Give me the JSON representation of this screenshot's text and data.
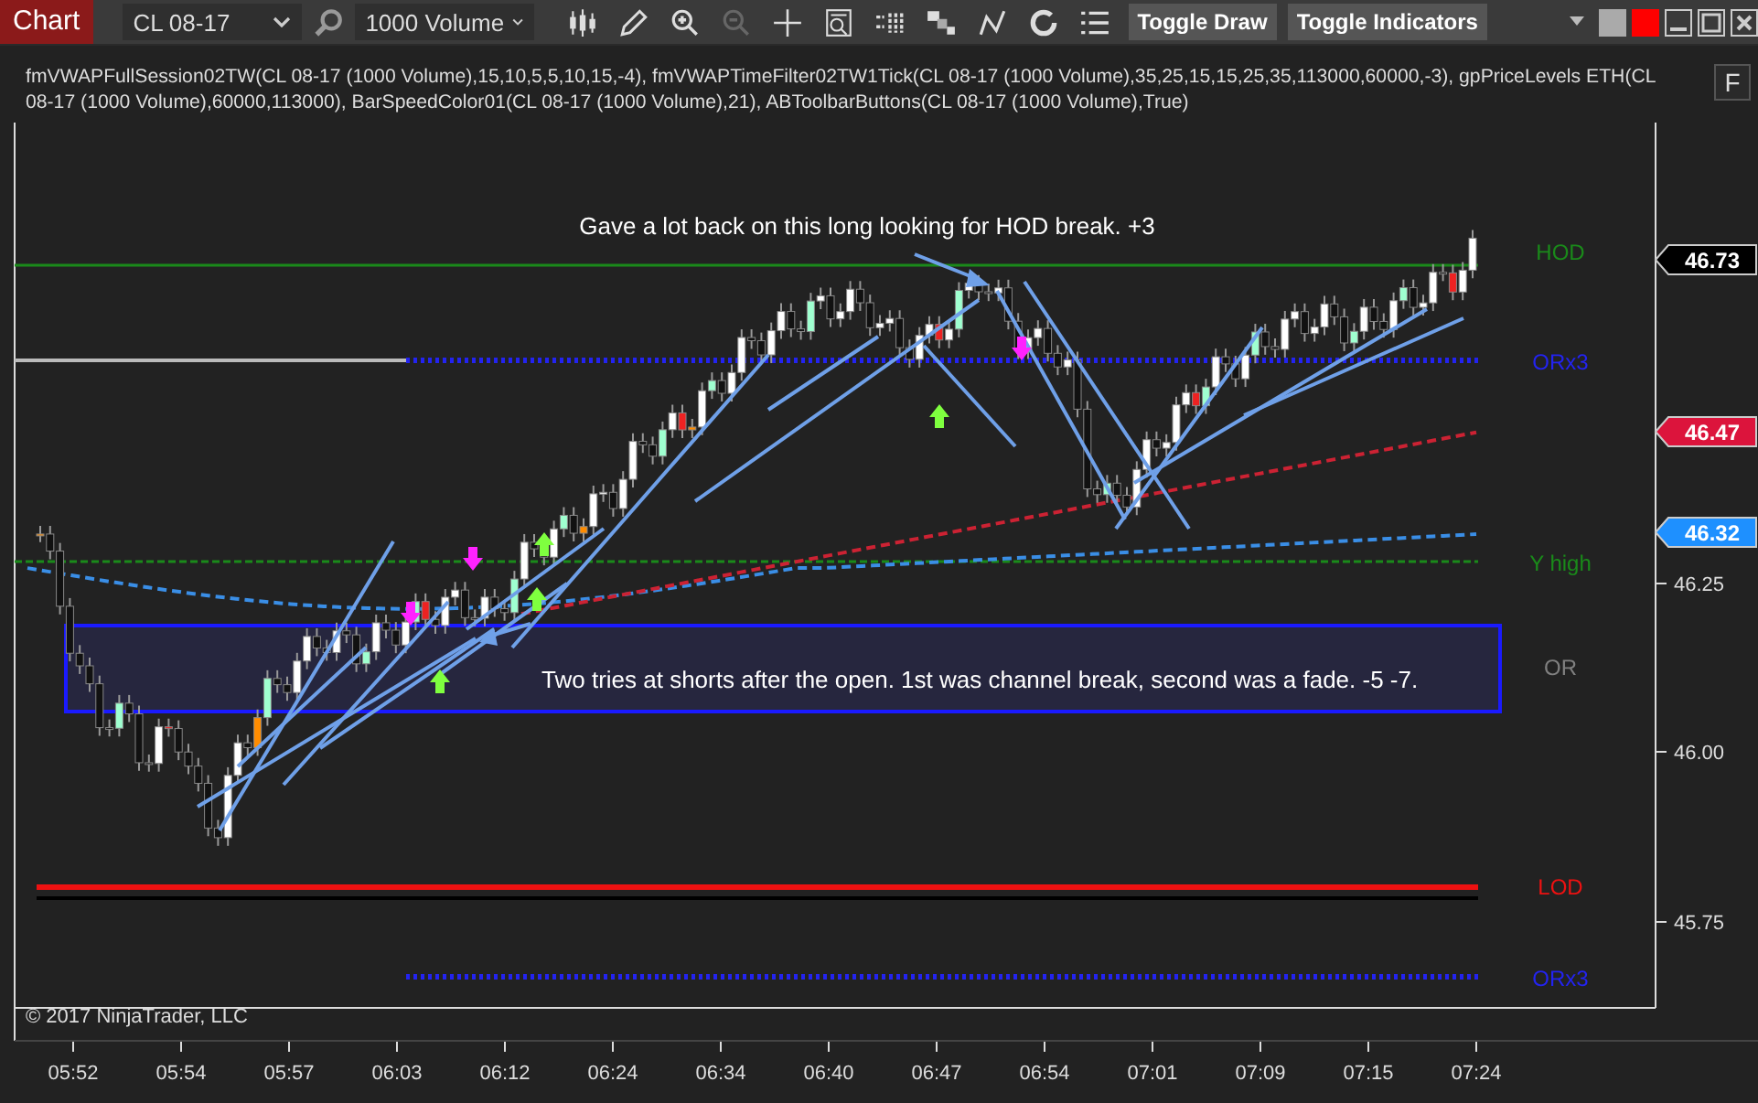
{
  "toolbar": {
    "title": "Chart",
    "instrument": "CL 08-17",
    "interval": "1000 Volume",
    "buttons": [
      "Toggle Draw",
      "Toggle Indicators"
    ]
  },
  "indicators_text": "fmVWAPFullSession02TW(CL 08-17 (1000 Volume),15,10,5,5,10,15,-4), fmVWAPTimeFilter02TW1Tick(CL 08-17 (1000 Volume),35,25,15,15,25,35,113000,60000,-3), gpPriceLevels ETH(CL 08-17 (1000 Volume),60000,113000), BarSpeedColor01(CL 08-17 (1000 Volume),21), ABToolbarButtons(CL 08-17 (1000 Volume),True)",
  "side_button": "F",
  "annotations": [
    "Gave a lot back on this long looking for HOD break.  +3",
    "Two tries at shorts after the open. 1st was channel break, second was a fade. -5 -7."
  ],
  "levels": [
    {
      "label": "HOD",
      "color": "#1a8a1a"
    },
    {
      "label": "ORx3",
      "color": "#2323f0"
    },
    {
      "label": "Y high",
      "color": "#1a8a1a"
    },
    {
      "label": "OR",
      "color": "#808080"
    },
    {
      "label": "LOD",
      "color": "#ee1111"
    },
    {
      "label": "ORx3",
      "color": "#2323f0"
    }
  ],
  "price_flags": [
    {
      "value": "46.73",
      "color": "#000000"
    },
    {
      "value": "46.47",
      "color": "#dc143c"
    },
    {
      "value": "46.32",
      "color": "#1e90ff"
    }
  ],
  "y_ticks": [
    "46.25",
    "46.00",
    "45.75"
  ],
  "x_ticks": [
    "05:52",
    "05:54",
    "05:57",
    "06:03",
    "06:12",
    "06:24",
    "06:34",
    "06:40",
    "06:47",
    "06:54",
    "07:01",
    "07:09",
    "07:15",
    "07:24"
  ],
  "copyright": "© 2017 NinjaTrader, LLC"
}
